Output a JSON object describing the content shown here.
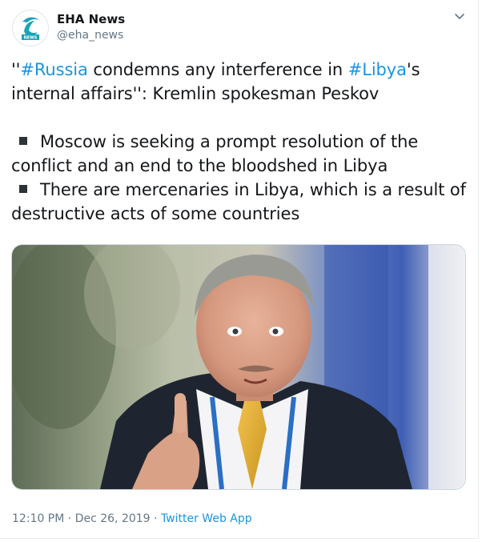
{
  "account": {
    "display_name": "EHA News",
    "handle": "@eha_news",
    "avatar_label": "NEWS"
  },
  "tweet": {
    "line1_prefix": "''",
    "hashtag_russia": "#Russia",
    "line1_mid": " condemns any interference in ",
    "hashtag_libya": "#Libya",
    "line1_suffix": "'s internal affairs'': Kremlin spokesman Peskov",
    "bullet1": "Moscow is seeking a prompt resolution of the conflict and an end to the bloodshed in Libya",
    "bullet2": "There are mercenaries in Libya, which is a result of destructive acts of some countries"
  },
  "meta": {
    "time": "12:10 PM",
    "separator": " · ",
    "date": "Dec 26, 2019",
    "separator2": " · ",
    "source": "Twitter Web App"
  },
  "colors": {
    "link": "#1b95e0",
    "secondary_text": "#657786",
    "primary_text": "#14171a",
    "avatar_accent": "#1aa3b8"
  },
  "icons": {
    "caret": "chevron-down-icon",
    "bullet": "black-square-icon"
  }
}
